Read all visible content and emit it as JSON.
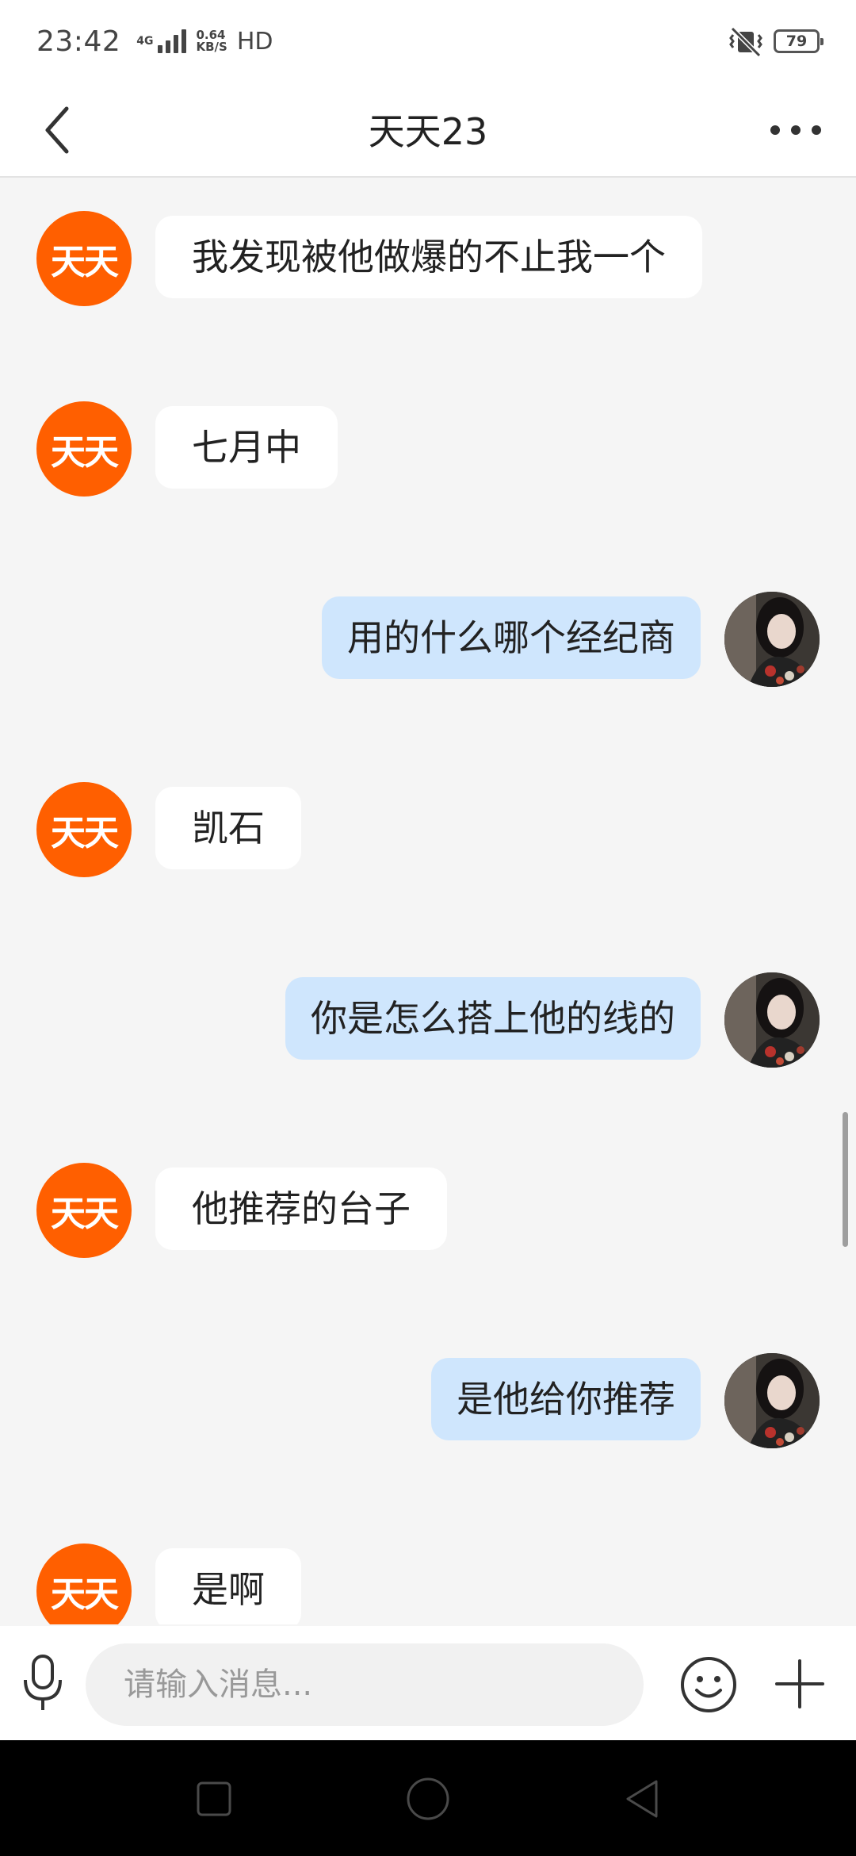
{
  "status_bar": {
    "time": "23:42",
    "network": "4G",
    "speed_value": "0.64",
    "speed_unit": "KB/S",
    "hd": "HD",
    "battery": "79",
    "icons": [
      "signal-icon",
      "vibrate-icon",
      "battery-icon"
    ]
  },
  "header": {
    "title": "天天23",
    "back_icon": "chevron-left-icon",
    "more_icon": "more-dots-icon"
  },
  "contact_avatar_text": "天天",
  "messages": [
    {
      "side": "left",
      "text": "我发现被他做爆的不止我一个"
    },
    {
      "side": "left",
      "text": "七月中"
    },
    {
      "side": "right",
      "text": "用的什么哪个经纪商"
    },
    {
      "side": "left",
      "text": "凯石"
    },
    {
      "side": "right",
      "text": "你是怎么搭上他的线的"
    },
    {
      "side": "left",
      "text": "他推荐的台子"
    },
    {
      "side": "right",
      "text": "是他给你推荐"
    },
    {
      "side": "left",
      "text": "是啊"
    }
  ],
  "input": {
    "placeholder": "请输入消息...",
    "value": ""
  },
  "toolbar_icons": [
    "microphone-icon",
    "emoji-icon",
    "plus-icon"
  ],
  "nav_icons": [
    "recent-apps-icon",
    "home-icon",
    "back-icon"
  ],
  "colors": {
    "contact_avatar": "#ff5f00",
    "my_bubble": "#cfe6fd",
    "their_bubble": "#ffffff",
    "background": "#f5f5f5"
  }
}
